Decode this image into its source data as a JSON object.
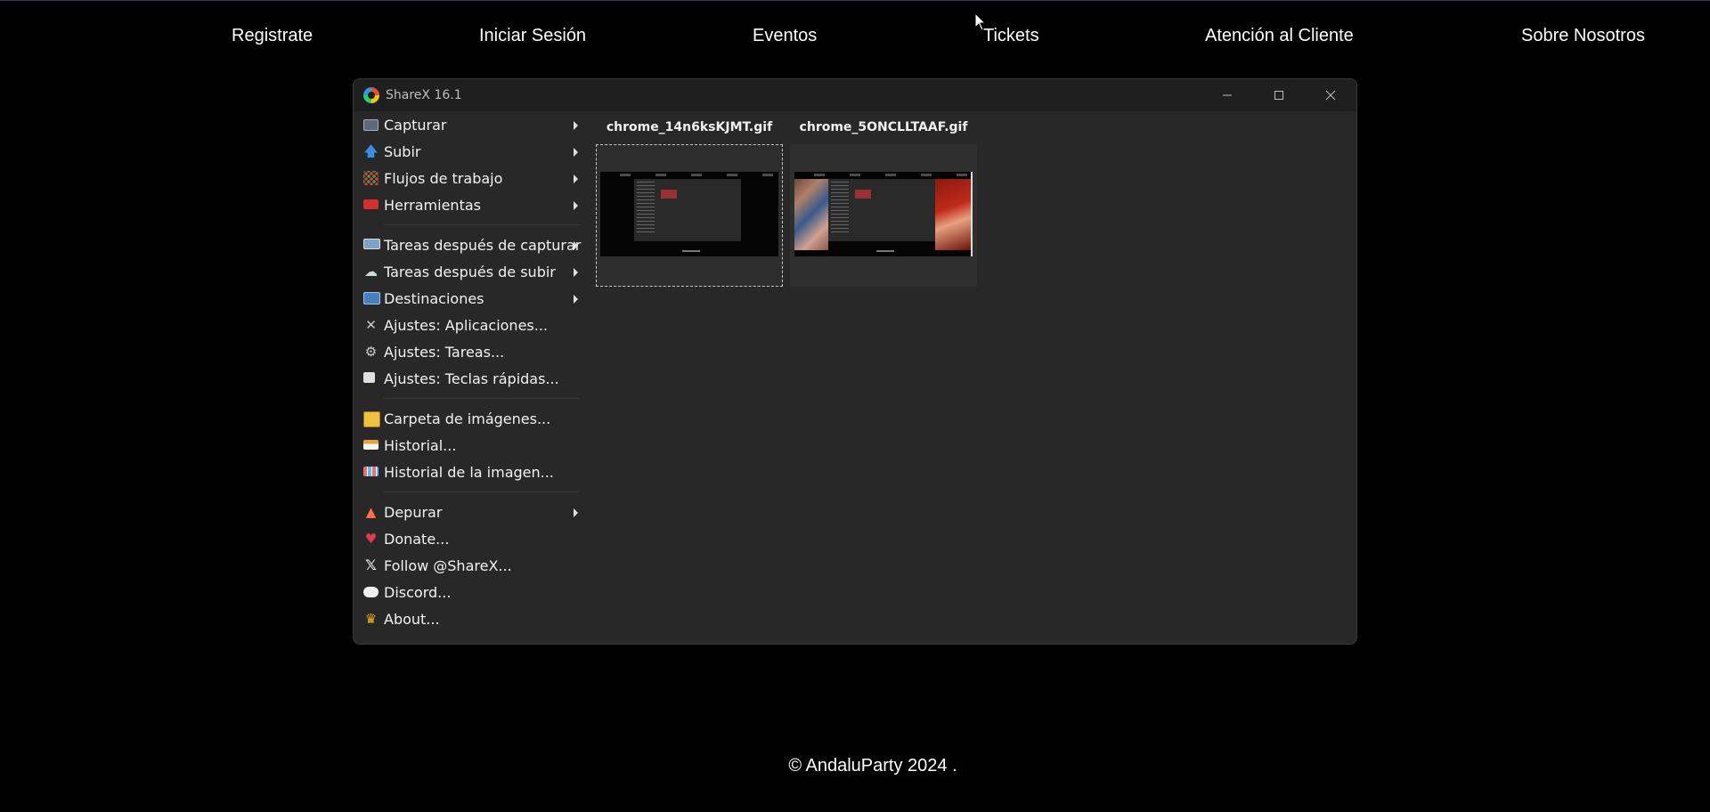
{
  "nav": {
    "items": [
      "Registrate",
      "Iniciar Sesión",
      "Eventos",
      "Tickets",
      "Atención al Cliente",
      "Sobre Nosotros"
    ]
  },
  "window": {
    "title": "ShareX 16.1",
    "controls": [
      "minimize-icon",
      "maximize-icon",
      "close-icon"
    ]
  },
  "menu": {
    "items": [
      {
        "label": "Capturar",
        "icon": "capture-icon",
        "submenu": true
      },
      {
        "label": "Subir",
        "icon": "upload-arrow-icon",
        "submenu": true
      },
      {
        "label": "Flujos de trabajo",
        "icon": "workflows-grid-icon",
        "submenu": true
      },
      {
        "label": "Herramientas",
        "icon": "toolbox-icon",
        "submenu": true
      },
      {
        "label": "Tareas después de capturar",
        "icon": "after-capture-icon",
        "submenu": true
      },
      {
        "label": "Tareas después de subir",
        "icon": "cloud-icon",
        "submenu": true
      },
      {
        "label": "Destinaciones",
        "icon": "destinations-icon",
        "submenu": true
      },
      {
        "label": "Ajustes: Aplicaciones...",
        "icon": "wrench-icon",
        "submenu": false
      },
      {
        "label": "Ajustes: Tareas...",
        "icon": "gear-icon",
        "submenu": false
      },
      {
        "label": "Ajustes: Teclas rápidas...",
        "icon": "keyboard-icon",
        "submenu": false
      },
      {
        "label": "Carpeta de imágenes...",
        "icon": "folder-icon",
        "submenu": false
      },
      {
        "label": "Historial...",
        "icon": "history-icon",
        "submenu": false
      },
      {
        "label": "Historial de la imagen...",
        "icon": "image-history-icon",
        "submenu": false
      },
      {
        "label": "Depurar",
        "icon": "traffic-cone-icon",
        "submenu": true
      },
      {
        "label": "Donate...",
        "icon": "heart-icon",
        "submenu": false
      },
      {
        "label": "Follow @ShareX...",
        "icon": "x-logo-icon",
        "submenu": false
      },
      {
        "label": "Discord...",
        "icon": "discord-icon",
        "submenu": false
      },
      {
        "label": "About...",
        "icon": "crown-icon",
        "submenu": false
      }
    ]
  },
  "thumbnails": [
    {
      "name": "chrome_14n6ksKJMT.gif"
    },
    {
      "name": "chrome_5ONCLLTAAF.gif"
    }
  ],
  "footer": {
    "text": "© AndaluParty 2024 ."
  },
  "colors": {
    "page_bg": "#000000",
    "window_bg": "#282828",
    "titlebar_bg": "#1f1f1f",
    "text": "#f2f2f2"
  }
}
